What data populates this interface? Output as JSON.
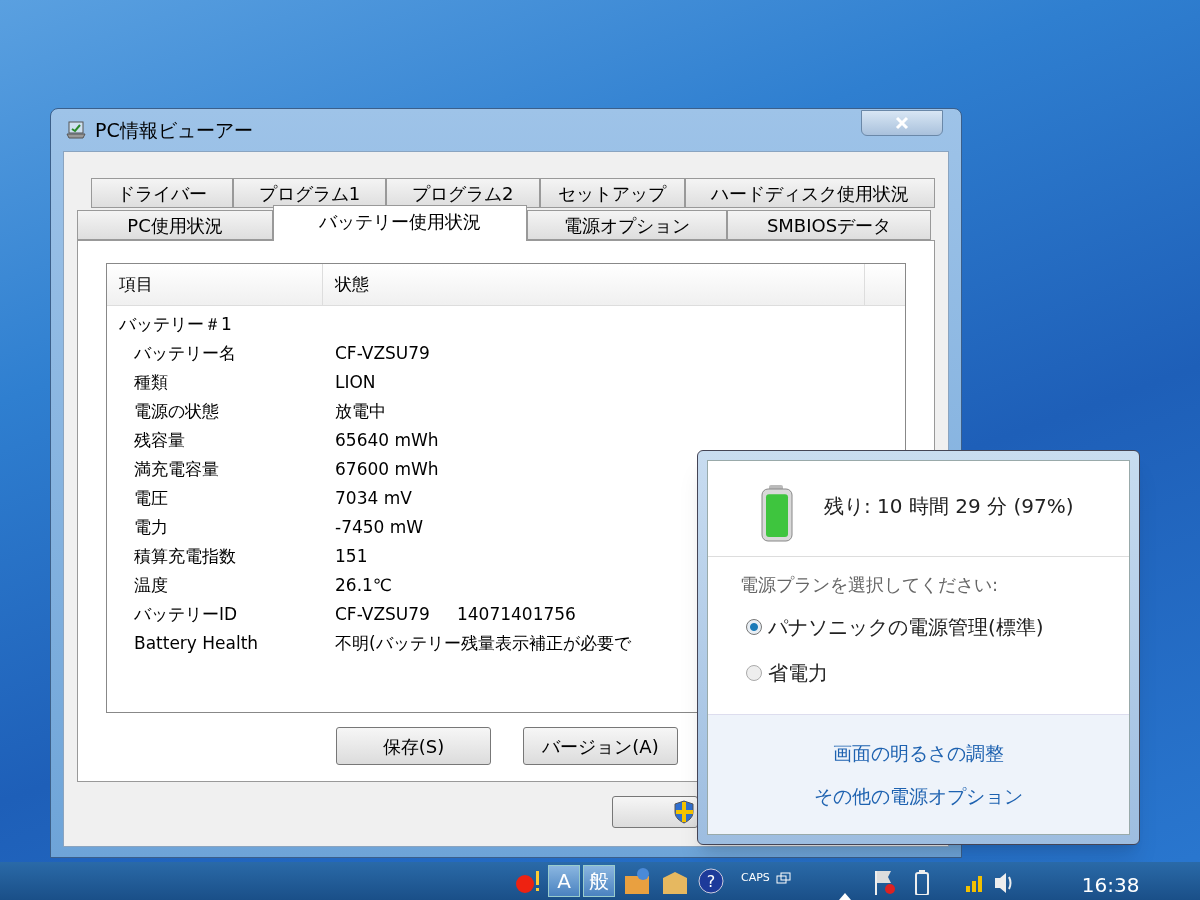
{
  "window": {
    "title": "PC情報ビューアー"
  },
  "tab_rows": [
    [
      {
        "label": "ドライバー",
        "selected": false
      },
      {
        "label": "プログラム1",
        "selected": false
      },
      {
        "label": "プログラム2",
        "selected": false
      },
      {
        "label": "セットアップ",
        "selected": false
      },
      {
        "label": "ハードディスク使用状況",
        "selected": false
      }
    ],
    [
      {
        "label": "PC使用状況",
        "selected": false
      },
      {
        "label": "バッテリー使用状況",
        "selected": true
      },
      {
        "label": "電源オプション",
        "selected": false
      },
      {
        "label": "SMBIOSデータ",
        "selected": false
      }
    ]
  ],
  "table": {
    "columns": [
      "項目",
      "状態"
    ],
    "groups": [
      {
        "label": "バッテリー＃1",
        "rows": [
          {
            "item": "バッテリー名",
            "value": "CF-VZSU79"
          },
          {
            "item": "種類",
            "value": "LION"
          },
          {
            "item": "電源の状態",
            "value": "放電中"
          },
          {
            "item": "残容量",
            "value": "65640 mWh"
          },
          {
            "item": "満充電容量",
            "value": "67600 mWh"
          },
          {
            "item": "電圧",
            "value": "7034 mV"
          },
          {
            "item": "電力",
            "value": "-7450 mW"
          },
          {
            "item": "積算充電指数",
            "value": "151"
          },
          {
            "item": "温度",
            "value": "26.1℃"
          },
          {
            "item": "バッテリーID",
            "value": "CF-VZSU79     14071401756"
          },
          {
            "item": "Battery Health",
            "value": "不明(バッテリー残量表示補正が必要で"
          }
        ]
      }
    ]
  },
  "buttons": [
    "保存(S)",
    "バージョン(A)"
  ],
  "power_popup": {
    "remaining": "残り: 10 時間 29 分 (97%)",
    "level": 0.97,
    "prompt": "電源プランを選択してください:",
    "plans": [
      {
        "label": "パナソニックの電源管理(標準)",
        "selected": true
      },
      {
        "label": "省電力",
        "selected": false
      }
    ],
    "links": [
      "画面の明るさの調整",
      "その他の電源オプション"
    ]
  },
  "taskbar": {
    "ime": [
      "A",
      "般"
    ],
    "help": "?",
    "caps": "CAPS",
    "clock": "16:38"
  }
}
